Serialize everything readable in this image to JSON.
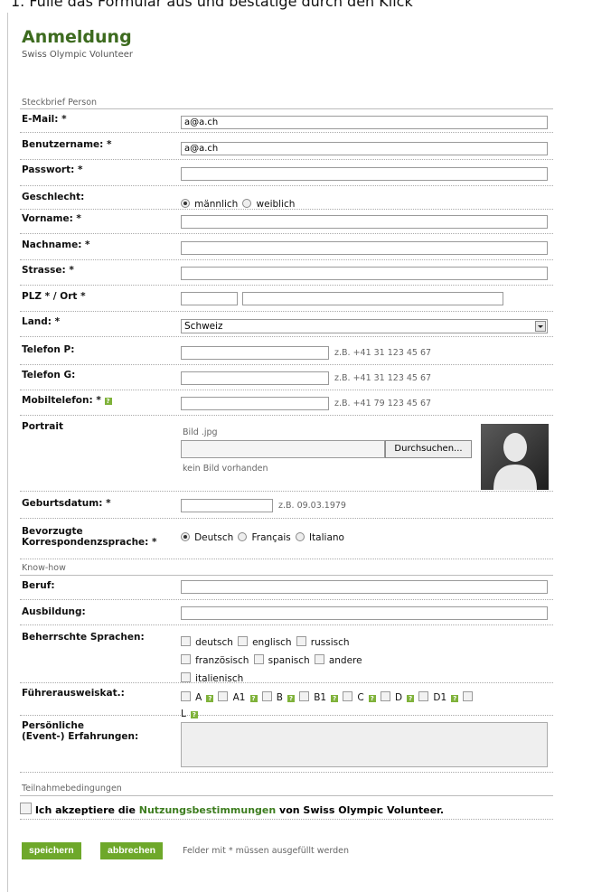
{
  "top_text": "1. Fülle das Formular aus und bestätige durch den Klick",
  "header": {
    "title": "Anmeldung",
    "subtitle": "Swiss Olympic Volunteer"
  },
  "sections": {
    "person": "Steckbrief Person",
    "knowhow": "Know-how",
    "conditions": "Teilnahmebedingungen"
  },
  "fields": {
    "email": {
      "label": "E-Mail: *",
      "value": "a@a.ch"
    },
    "username": {
      "label": "Benutzername: *",
      "value": "a@a.ch"
    },
    "password": {
      "label": "Passwort: *",
      "value": ""
    },
    "gender": {
      "label": "Geschlecht:",
      "options": [
        "männlich",
        "weiblich"
      ],
      "selected": "männlich"
    },
    "firstname": {
      "label": "Vorname: *",
      "value": ""
    },
    "lastname": {
      "label": "Nachname: *",
      "value": ""
    },
    "street": {
      "label": "Strasse: *",
      "value": ""
    },
    "plz_ort": {
      "label": "PLZ * / Ort *",
      "plz": "",
      "ort": ""
    },
    "country": {
      "label": "Land: *",
      "value": "Schweiz"
    },
    "phone_p": {
      "label": "Telefon P:",
      "hint": "z.B. +41 31 123 45 67"
    },
    "phone_g": {
      "label": "Telefon G:",
      "hint": "z.B. +41 31 123 45 67"
    },
    "mobile": {
      "label": "Mobiltelefon: *",
      "hint": "z.B. +41 79 123 45 67"
    },
    "portrait": {
      "label": "Portrait",
      "hint": "Bild .jpg",
      "browse": "Durchsuchen...",
      "status": "kein Bild vorhanden"
    },
    "birthdate": {
      "label": "Geburtsdatum: *",
      "hint": "z.B. 09.03.1979"
    },
    "language": {
      "label_line1": "Bevorzugte",
      "label_line2": "Korrespondenzsprache: *",
      "options": [
        "Deutsch",
        "Français",
        "Italiano"
      ],
      "selected": "Deutsch"
    },
    "profession": {
      "label": "Beruf:"
    },
    "education": {
      "label": "Ausbildung:"
    },
    "languages_spoken": {
      "label": "Beherrschte Sprachen:",
      "options": [
        "deutsch",
        "englisch",
        "russisch",
        "französisch",
        "spanisch",
        "andere",
        "italienisch"
      ]
    },
    "license": {
      "label": "Führerausweiskat.:",
      "options": [
        "A",
        "A1",
        "B",
        "B1",
        "C",
        "D",
        "D1",
        "L"
      ]
    },
    "experience": {
      "label_line1": "Persönliche",
      "label_line2": "(Event-) Erfahrungen:"
    }
  },
  "terms": {
    "prefix": "Ich akzeptiere die",
    "link": "Nutzungsbestimmungen",
    "suffix": "von Swiss Olympic Volunteer."
  },
  "footer": {
    "save": "speichern",
    "cancel": "abbrechen",
    "note": "Felder mit * müssen ausgefüllt werden"
  },
  "colors": {
    "accent": "#6ea82a",
    "title": "#3d6b1f"
  }
}
